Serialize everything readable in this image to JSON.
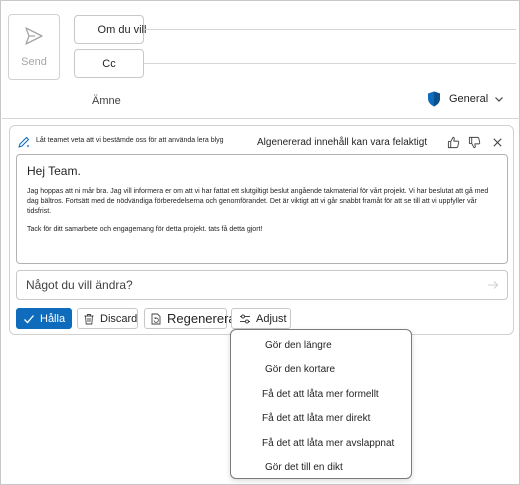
{
  "header": {
    "send_label": "Send",
    "to_label": "Om du vill",
    "cc_label": "Cc",
    "subject_label": "Ämne",
    "sensitivity_label": "General"
  },
  "copilot": {
    "prompt_text": "Låt teamet veta att vi bestämde oss för att använda lera blyg",
    "disclaimer": "Algenererad innehåll kan vara felaktigt",
    "draft": {
      "greeting": "Hej Team.",
      "paragraph1": "Jag hoppas att ni mår bra. Jag vill informera er om att vi har fattat ett slutgiltigt beslut angående takmaterial för vårt projekt. Vi har beslutat att gå med dag bältros. Fortsätt med de nödvändiga förberedelserna och genomförandet. Det är viktigt att vi går snabbt framåt för att se till att vi uppfyller vår tidsfrist.",
      "paragraph2": "Tack för ditt samarbete och engagemang för detta projekt. tats få detta gjort!"
    },
    "ask_placeholder": "Något du vill ändra?",
    "buttons": {
      "keep": "Hålla",
      "discard": "Discard",
      "regenerate": "Regenerera",
      "adjust": "Adjust"
    }
  },
  "adjust_menu": {
    "items": [
      "Gör den längre",
      "Gör den kortare",
      "Få det att låta mer formellt",
      "Få det att låta mer direkt",
      "Få det att låta mer avslappnat",
      "Gör det till en dikt"
    ]
  },
  "colors": {
    "accent": "#0f6cbd",
    "shield": "#0f6cbd"
  }
}
